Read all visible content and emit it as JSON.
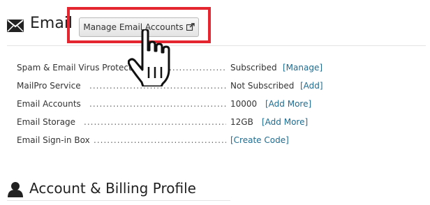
{
  "email_section": {
    "title": "Email",
    "icon": "envelope-icon",
    "manage_button_label": "Manage Email Accounts",
    "manage_button_icon": "external-link-icon",
    "highlight_color": "#e3262f"
  },
  "rows": [
    {
      "label": "Spam & Email Virus Protection",
      "value": "Subscribed",
      "action": "[Manage]"
    },
    {
      "label": "MailPro Service",
      "value": "Not Subscribed",
      "action": "[Add]"
    },
    {
      "label": "Email Accounts",
      "value": "10000",
      "action": "[Add More]"
    },
    {
      "label": "Email Storage",
      "value": "12GB",
      "action": "[Add More]"
    },
    {
      "label": "Email Sign-in Box",
      "value": "",
      "action": "[Create Code]"
    }
  ],
  "account_section": {
    "title": "Account & Billing Profile",
    "icon": "user-icon"
  },
  "colors": {
    "link": "#1f6b8f",
    "highlight": "#e3262f"
  }
}
